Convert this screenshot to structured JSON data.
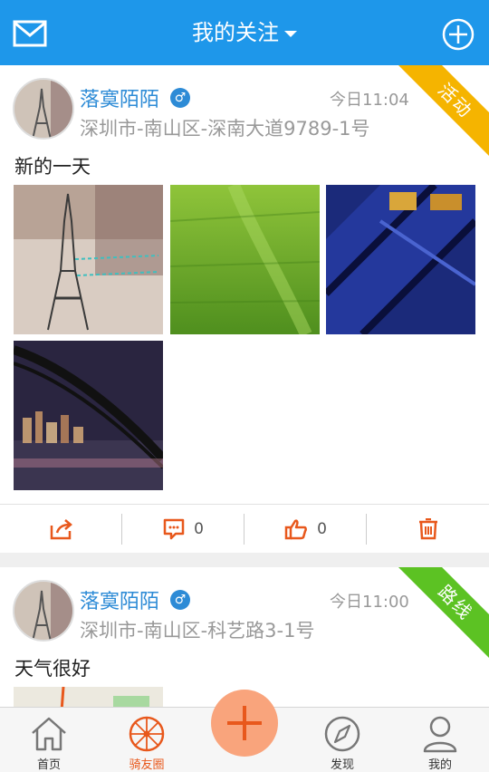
{
  "header": {
    "title": "我的关注",
    "mail_icon": "mail-icon",
    "add_icon": "plus-circle-icon"
  },
  "posts": [
    {
      "user": "落寞陌陌",
      "gender_symbol": "♂",
      "time": "今日11:04",
      "location": "深圳市-南山区-深南大道9789-1号",
      "text": "新的一天",
      "ribbon": "活动",
      "ribbon_color": "#f5b400",
      "photos": [
        "paris-eiffel-tower-photo",
        "green-grass-photo",
        "blue-steel-structure-photo",
        "night-bridge-city-photo"
      ],
      "comment_count": "0",
      "like_count": "0"
    },
    {
      "user": "落寞陌陌",
      "gender_symbol": "♂",
      "time": "今日11:00",
      "location": "深圳市-南山区-科艺路3-1号",
      "text": "天气很好",
      "ribbon": "路线",
      "ribbon_color": "#5cc223"
    }
  ],
  "tabs": [
    {
      "label": "首页",
      "icon": "home-icon",
      "active": false
    },
    {
      "label": "骑友圈",
      "icon": "bike-wheel-icon",
      "active": true
    },
    {
      "label": "发现",
      "icon": "compass-icon",
      "active": false
    },
    {
      "label": "我的",
      "icon": "user-icon",
      "active": false
    }
  ],
  "colors": {
    "primary": "#1e97ea",
    "accent": "#e8581c",
    "username": "#2d8bd6"
  }
}
